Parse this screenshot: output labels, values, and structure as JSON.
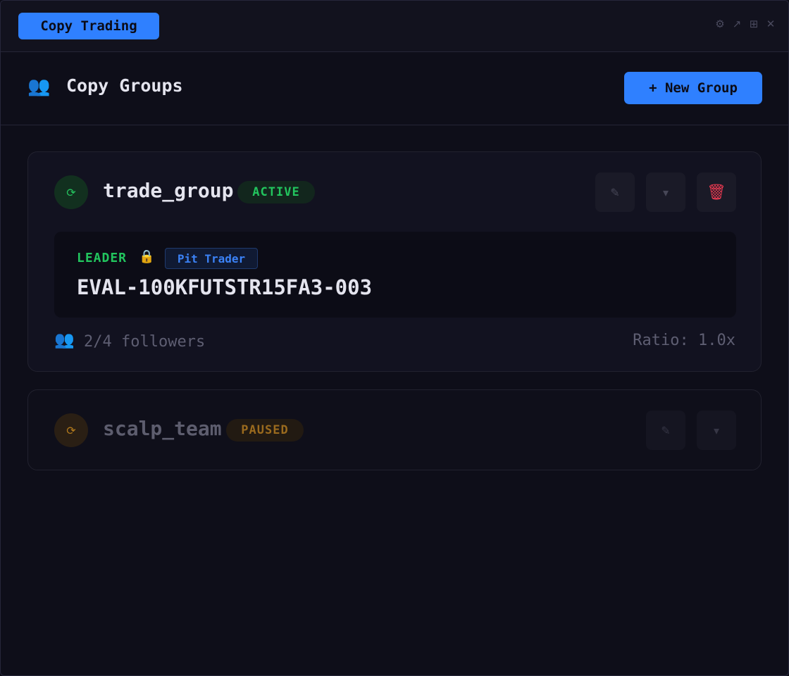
{
  "window": {
    "tab_label": "Copy Trading",
    "controls": [
      {
        "name": "gear-icon",
        "glyph": "⚙"
      },
      {
        "name": "popout-icon",
        "glyph": "↗"
      },
      {
        "name": "grid-icon",
        "glyph": "⊞"
      },
      {
        "name": "close-icon",
        "glyph": "✕"
      }
    ]
  },
  "header": {
    "icon": "people-icon",
    "icon_glyph": "👥",
    "title": "Copy Groups",
    "new_group_label": "+ New Group"
  },
  "groups": [
    {
      "name": "trade_group",
      "status": "ACTIVE",
      "status_color": "#22c55e",
      "icon": "sync-icon",
      "icon_glyph": "⟳",
      "actions": {
        "edit_glyph": "✎",
        "expand_glyph": "▾",
        "delete_glyph": "🗑"
      },
      "leader": {
        "label": "LEADER",
        "lock_glyph": "🔒",
        "tag": "Pit Trader",
        "account_id": "EVAL-100KFUTSTR15FA3-003"
      },
      "followers_glyph": "👥",
      "followers_text": "2/4 followers",
      "ratio_text": "Ratio: 1.0x"
    },
    {
      "name": "scalp_team",
      "status": "PAUSED",
      "status_color": "#9a6a1e",
      "icon": "sync-icon",
      "icon_glyph": "⟳",
      "actions": {
        "edit_glyph": "✎",
        "expand_glyph": "▾"
      }
    }
  ],
  "colors": {
    "accent": "#2f80ff",
    "active": "#22c55e",
    "paused": "#b27a1d",
    "danger": "#e53950",
    "background": "#0e0e19"
  }
}
